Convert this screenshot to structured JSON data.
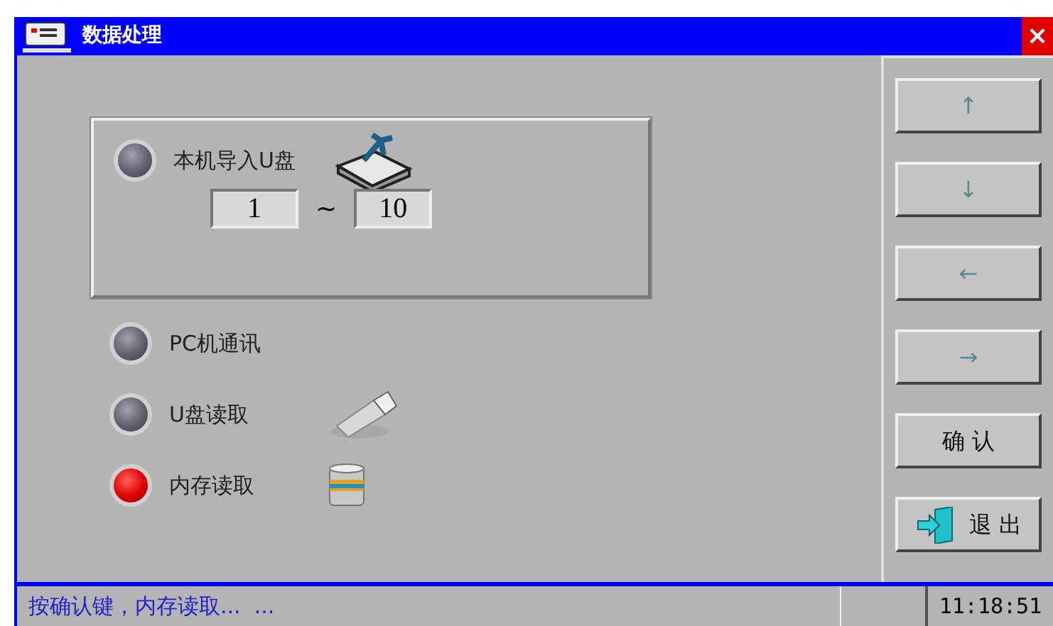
{
  "window": {
    "title": "数据处理",
    "close": "×"
  },
  "options": [
    {
      "kind": "usb-export",
      "label": "本机导入U盘",
      "selected": false,
      "range": {
        "from": "1",
        "separator": "~",
        "to": "10"
      }
    },
    {
      "kind": "pc",
      "label": "PC机通讯",
      "selected": false
    },
    {
      "kind": "usb-read",
      "label": "U盘读取",
      "selected": false
    },
    {
      "kind": "memory-read",
      "label": "内存读取",
      "selected": true
    }
  ],
  "buttons": [
    {
      "kind": "arrow",
      "label": "↑"
    },
    {
      "kind": "arrow",
      "label": "↓"
    },
    {
      "kind": "arrow",
      "label": "←"
    },
    {
      "kind": "arrow",
      "label": "→"
    },
    {
      "kind": "text",
      "label": "确 认"
    },
    {
      "kind": "exit",
      "label": "退 出"
    }
  ],
  "status_bar": {
    "message": "按确认键，内存读取...  ...",
    "time": "11:18:51"
  }
}
